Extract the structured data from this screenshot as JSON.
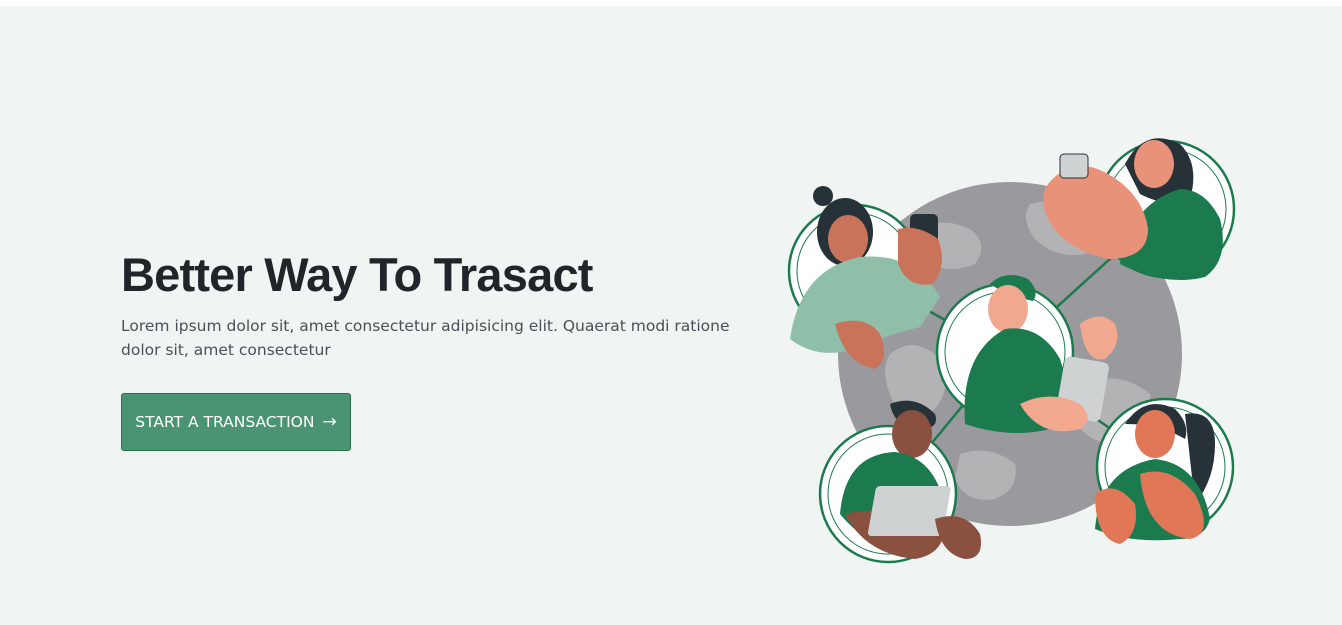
{
  "hero": {
    "title": "Better Way To Trasact",
    "description": "Lorem ipsum dolor sit, amet consectetur adipisicing elit. Quaerat modi ratione dolor sit, amet consectetur",
    "cta_label": "START A TRANSACTION",
    "cta_icon": "arrow-right-icon",
    "illustration_icon": "global-network-people-illustration"
  },
  "colors": {
    "background": "#f0f5f3",
    "title": "#212529",
    "text": "#495057",
    "button": "#4a9474",
    "accent_green": "#1b7a4e",
    "globe": "#9a9a9e"
  }
}
